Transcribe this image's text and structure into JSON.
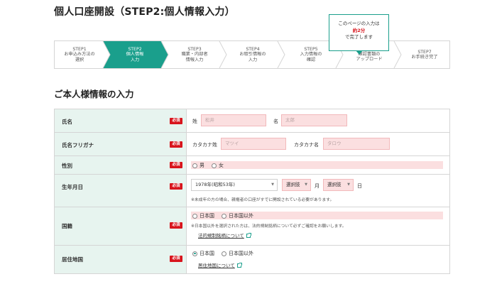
{
  "header": {
    "title": "個人口座開設（STEP2:個人情報入力）"
  },
  "tooltip": {
    "line1": "このページの入力は",
    "line2": "約2分",
    "line3": "で完了します"
  },
  "steps": [
    {
      "num": "STEP1",
      "label1": "お申込み方法の",
      "label2": "選択"
    },
    {
      "num": "STEP2",
      "label1": "個人情報",
      "label2": "入力"
    },
    {
      "num": "STEP3",
      "label1": "職業・内部者",
      "label2": "情報入力"
    },
    {
      "num": "STEP4",
      "label1": "お取引情報の",
      "label2": "入力"
    },
    {
      "num": "STEP5",
      "label1": "入力情報の",
      "label2": "確認"
    },
    {
      "num": "",
      "label1": "確認書類の",
      "label2": "アップロード"
    },
    {
      "num": "STEP7",
      "label1": "お手続き完了",
      "label2": ""
    }
  ],
  "section": {
    "title": "ご本人様情報の入力"
  },
  "required_label": "必須",
  "colors": {
    "accent": "#1a9f8c",
    "required": "#d8151d",
    "label_bg": "#e7f4ef",
    "input_bg": "#fbdfe0"
  },
  "form": {
    "name": {
      "label": "氏名",
      "sei_label": "姓",
      "sei_placeholder": "松井",
      "mei_label": "名",
      "mei_placeholder": "太郎"
    },
    "kana": {
      "label": "氏名フリガナ",
      "sei_label": "カタカナ姓",
      "sei_placeholder": "マツイ",
      "mei_label": "カタカナ名",
      "mei_placeholder": "タロウ"
    },
    "gender": {
      "label": "性別",
      "options": [
        "男",
        "女"
      ]
    },
    "birthday": {
      "label": "生年月日",
      "year_value": "1978年(昭和53年)",
      "month_value": "選択肢",
      "month_unit": "月",
      "day_value": "選択肢",
      "day_unit": "日",
      "note": "※未成年の方の場合、親権者の口座がすでに開設されている必要があります。"
    },
    "nationality": {
      "label": "国籍",
      "options": [
        "日本国",
        "日本国以外"
      ],
      "note": "※日本国以外を選択された方は、法的規制銘柄について必ずご確認をお願いします。",
      "link": "法的規制銘柄について"
    },
    "residence": {
      "label": "居住地国",
      "options": [
        "日本国",
        "日本国以外"
      ],
      "selected": "日本国",
      "link": "居住地国について"
    }
  }
}
